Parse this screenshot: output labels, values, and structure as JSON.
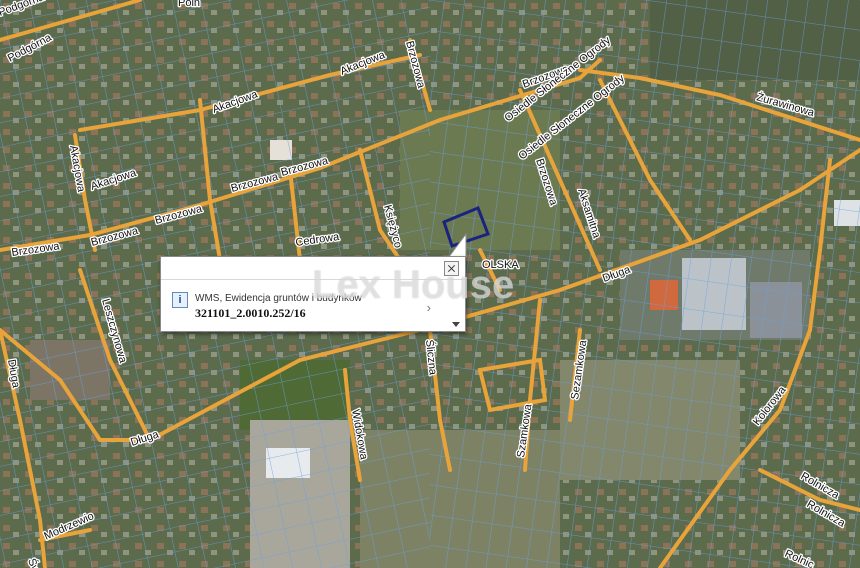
{
  "streets": {
    "podgorna_1": "Podgórna",
    "podgorna_2": "Podgórna",
    "akacjowa_top": "Akacjowa",
    "akacjowa_mid": "Akacjowa",
    "akacjowa_left": "Akacjowa",
    "akacjowa_vert": "Akacjowa",
    "brzozowa_top": "Brzozowa",
    "brzozowa_right": "Brzozowa",
    "brzozowa_mid1": "Brzozowa",
    "brzozowa_mid2": "Brzozowa",
    "brzozowa_left1": "Brzozowa",
    "brzozowa_left2": "Brzozowa",
    "brzozowa_far_left": "Brzozowa",
    "brzozowa_vert": "Brzozowa",
    "osiedle_1": "Osiedle Słoneczne Ogrody",
    "osiedle_2": "Osiedle Słoneczne Ogrody",
    "zurawinowa": "Żurawinowa",
    "akamitna": "Aksamitna",
    "cedrowa": "Cedrowa",
    "ksiezycowa": "Księżyco",
    "polska": "OLSKA",
    "dluga_right": "Długa",
    "dluga_left": "Długa",
    "dluga_far_left": "Długa",
    "leszczynowa": "Leszczynowa",
    "sliczna": "Śliczna",
    "widokowa": "Widokowa",
    "szamkowa": "Szamkowa",
    "sezamkowa": "Sezamkowa",
    "kolorowa": "Kolorowa",
    "rolnicza_1": "Rolnicza",
    "rolnicza_2": "Rolnicza",
    "rolnicza_3": "Rolnic",
    "modrzewiowa": "Modrzewio",
    "swierkowa": "Świe",
    "poln": "Poln"
  },
  "popup": {
    "layer_label": "WMS, Ewidencja gruntów i budynków",
    "parcel_id": "321101_2.0010.252/16",
    "info_icon": "info-icon",
    "close_icon": "close-icon",
    "next_icon": "chevron-right-icon",
    "scroll_icon": "triangle-down-icon"
  },
  "watermark": "Lex House",
  "colors": {
    "road": "#e8a33a",
    "parcel_line": "#6aa0e0",
    "highlight_parcel": "#1a237e"
  }
}
